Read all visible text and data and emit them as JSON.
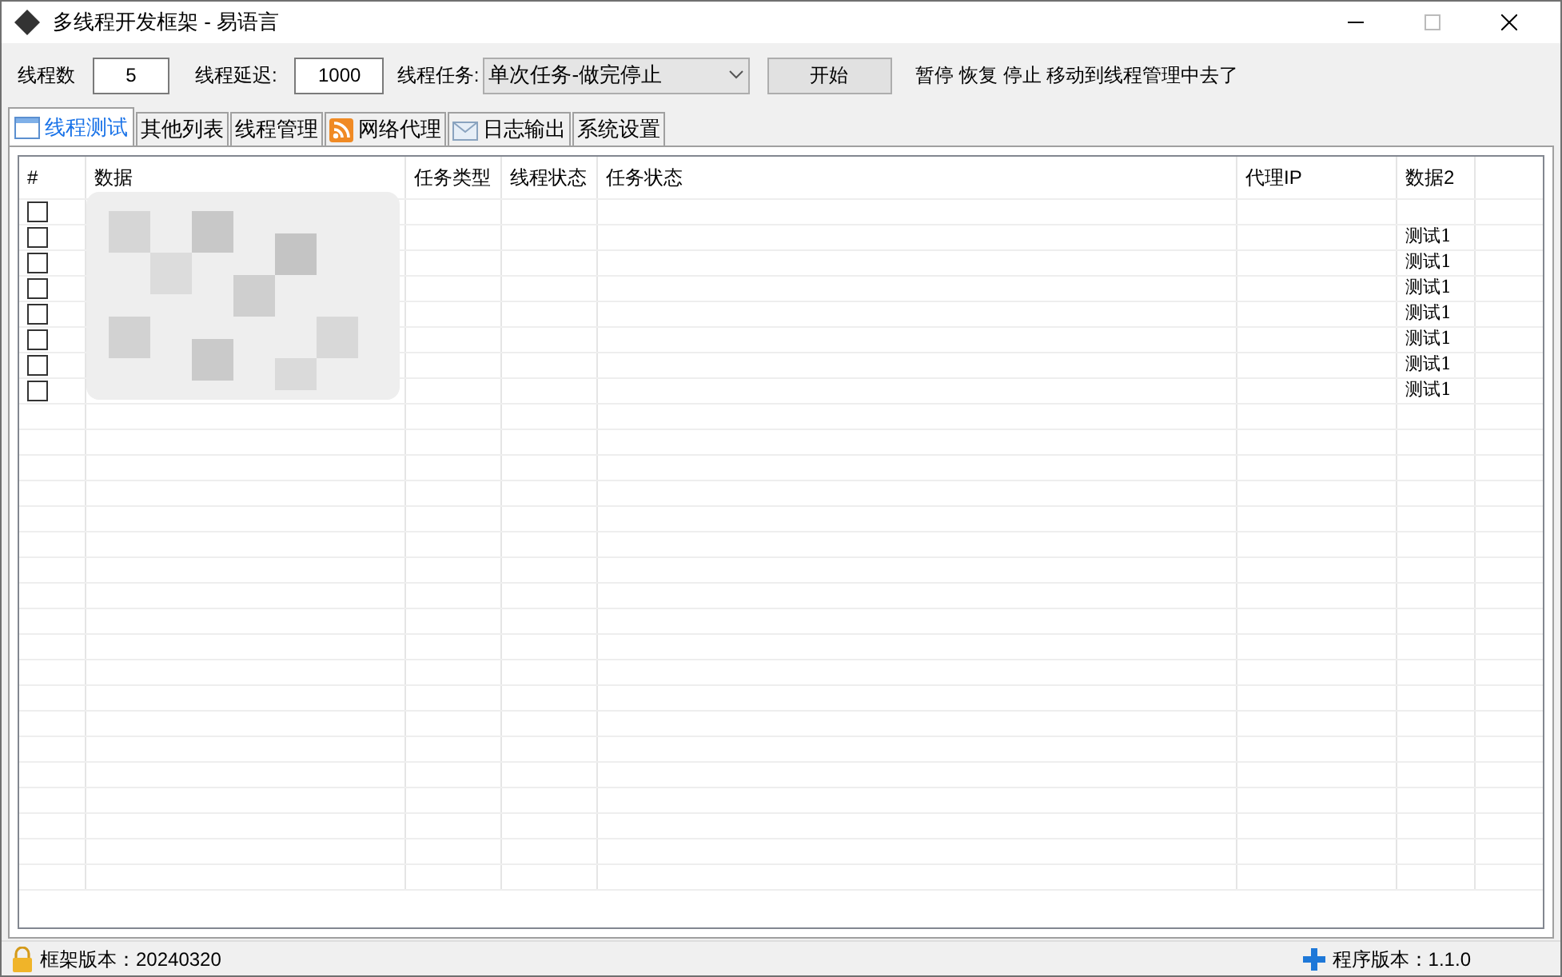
{
  "window": {
    "title": "多线程开发框架 - 易语言"
  },
  "toolbar": {
    "thread_count_label": "线程数",
    "thread_count": "5",
    "delay_label": "线程延迟:",
    "delay": "1000",
    "task_label": "线程任务:",
    "task": "单次任务-做完停止",
    "start_button": "开始",
    "note": "暂停 恢复 停止 移动到线程管理中去了"
  },
  "tabs": [
    {
      "label": "线程测试",
      "selected": true,
      "kind": "window"
    },
    {
      "label": "其他列表",
      "selected": false
    },
    {
      "label": "线程管理",
      "selected": false
    },
    {
      "label": "网络代理",
      "selected": false,
      "kind": "rss"
    },
    {
      "label": "日志输出",
      "selected": false,
      "kind": "mail"
    },
    {
      "label": "系统设置",
      "selected": false
    }
  ],
  "table": {
    "columns": [
      "#",
      "数据",
      "任务类型",
      "线程状态",
      "任务状态",
      "代理IP",
      "数据2"
    ],
    "rows": [
      {
        "checked": false,
        "data2": ""
      },
      {
        "checked": false,
        "data2": "测试1"
      },
      {
        "checked": false,
        "data2": "测试1"
      },
      {
        "checked": false,
        "data2": "测试1"
      },
      {
        "checked": false,
        "data2": "测试1"
      },
      {
        "checked": false,
        "data2": "测试1"
      },
      {
        "checked": false,
        "data2": "测试1"
      },
      {
        "checked": false,
        "data2": "测试1"
      }
    ]
  },
  "status_bar": {
    "left": "框架版本：20240320",
    "right": "程序版本：1.1.0"
  }
}
